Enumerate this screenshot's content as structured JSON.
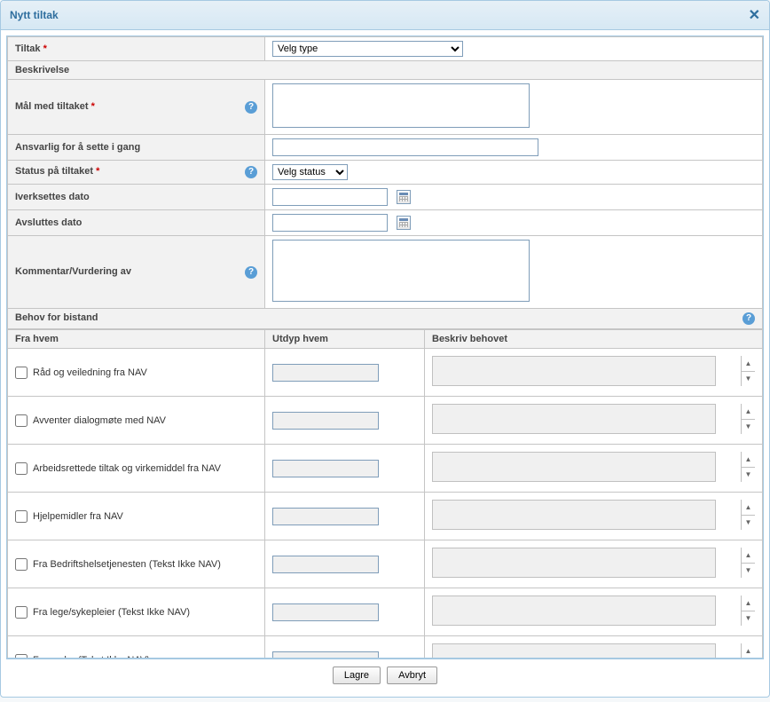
{
  "dialog": {
    "title": "Nytt tiltak"
  },
  "fields": {
    "tiltak_label": "Tiltak",
    "tiltak_select_default": "Velg type",
    "beskrivelse_label": "Beskrivelse",
    "mal_label": "Mål med tiltaket",
    "ansvarlig_label": "Ansvarlig for å sette i gang",
    "status_label": "Status på tiltaket",
    "status_select_default": "Velg status",
    "iverksettes_label": "Iverksettes dato",
    "avsluttes_label": "Avsluttes dato",
    "kommentar_label": "Kommentar/Vurdering av",
    "behov_label": "Behov for bistand"
  },
  "sub_headers": {
    "fra_hvem": "Fra hvem",
    "utdyp_hvem": "Utdyp hvem",
    "beskriv_behovet": "Beskriv behovet"
  },
  "bistand": [
    {
      "label": "Råd og veiledning fra NAV"
    },
    {
      "label": "Avventer dialogmøte med NAV"
    },
    {
      "label": "Arbeidsrettede tiltak og virkemiddel fra NAV"
    },
    {
      "label": "Hjelpemidler fra NAV"
    },
    {
      "label": "Fra Bedriftshelsetjenesten (Tekst Ikke NAV)"
    },
    {
      "label": "Fra lege/sykepleier (Tekst Ikke NAV)"
    },
    {
      "label": "Fra andre (Tekst Ikke NAV)"
    }
  ],
  "buttons": {
    "lagre": "Lagre",
    "avbryt": "Avbryt"
  }
}
